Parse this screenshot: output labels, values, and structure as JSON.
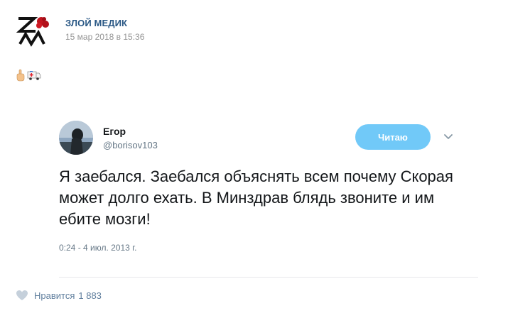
{
  "post": {
    "author": "ЗЛОЙ МЕДИК",
    "date": "15 мар 2018 в 15:36",
    "logo_icon": "zm-logo-icon",
    "emojis": [
      "hand-icon",
      "ambulance-icon"
    ]
  },
  "tweet": {
    "name": "Егор",
    "handle": "@borisov103",
    "follow_label": "Читаю",
    "text": "Я заебался. Заебался объяснять всем почему Скорая может долго ехать. В Минздрав блядь звоните и им ебите мозги!",
    "time": "0:24 - 4 июл. 2013 г."
  },
  "footer": {
    "like_label": "Нравится",
    "like_count": "1 883"
  },
  "colors": {
    "link_blue": "#2a5885",
    "follow_button": "#71c9f8",
    "muted": "#939393",
    "like_gray": "#5f7e9d"
  }
}
